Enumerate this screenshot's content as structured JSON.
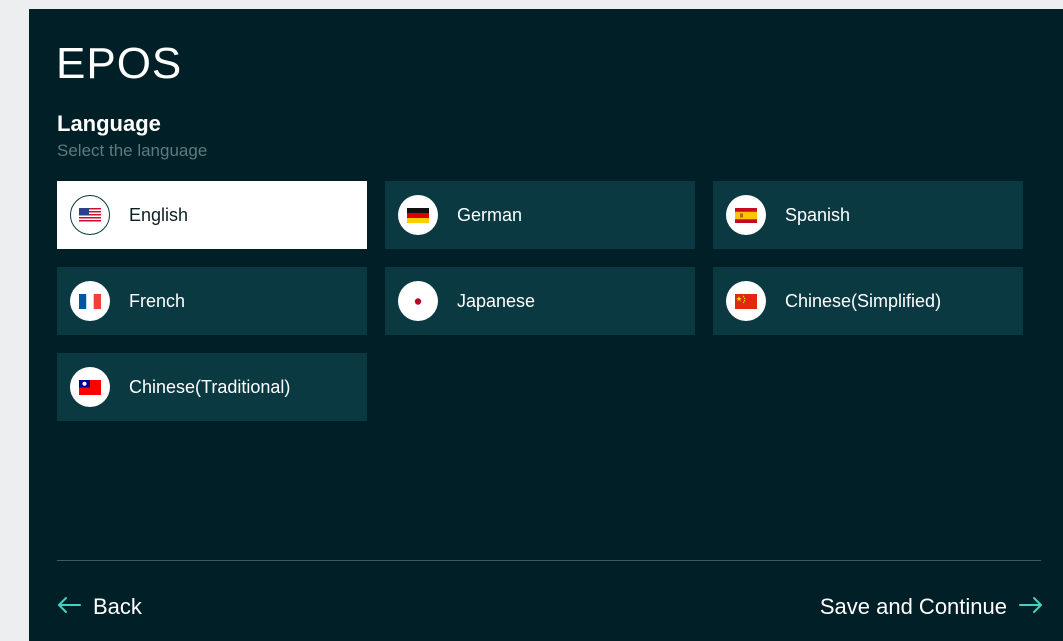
{
  "brand": {
    "logo_text": "EPOS"
  },
  "header": {
    "title": "Language",
    "subtitle": "Select the language"
  },
  "languages": [
    {
      "label": "English",
      "flag": "us-flag-icon",
      "selected": true
    },
    {
      "label": "German",
      "flag": "germany-flag-icon",
      "selected": false
    },
    {
      "label": "Spanish",
      "flag": "spain-flag-icon",
      "selected": false
    },
    {
      "label": "French",
      "flag": "france-flag-icon",
      "selected": false
    },
    {
      "label": "Japanese",
      "flag": "japan-flag-icon",
      "selected": false
    },
    {
      "label": "Chinese(Simplified)",
      "flag": "china-flag-icon",
      "selected": false
    },
    {
      "label": "Chinese(Traditional)",
      "flag": "taiwan-flag-icon",
      "selected": false
    }
  ],
  "footer": {
    "back_label": "Back",
    "continue_label": "Save and Continue"
  },
  "colors": {
    "background": "#011f26",
    "tile": "#0a3942",
    "tile_selected": "#ffffff",
    "accent_arrow": "#3dd6c3"
  }
}
